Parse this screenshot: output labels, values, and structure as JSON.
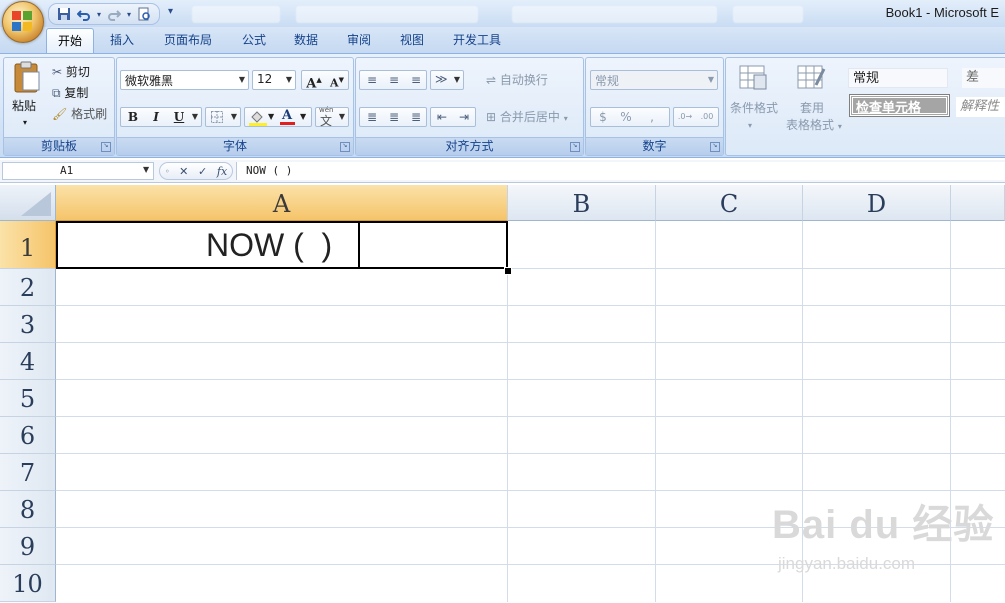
{
  "window": {
    "title": "Book1 - Microsoft E"
  },
  "quick_access": {
    "save_icon": "save-icon",
    "undo_icon": "undo-icon",
    "redo_icon": "redo-icon",
    "print_preview_icon": "print-preview-icon"
  },
  "tabs": [
    "开始",
    "插入",
    "页面布局",
    "公式",
    "数据",
    "审阅",
    "视图",
    "开发工具"
  ],
  "clipboard": {
    "paste_label": "粘贴",
    "cut_label": "剪切",
    "copy_label": "复制",
    "format_painter_label": "格式刷",
    "group_label": "剪贴板"
  },
  "font": {
    "name": "微软雅黑",
    "size": "12",
    "grow_label": "A",
    "shrink_label": "A",
    "bold": "B",
    "italic": "I",
    "underline": "U",
    "phonetic": "wén",
    "group_label": "字体",
    "font_color": "#e02020"
  },
  "alignment": {
    "wrap_label": "自动换行",
    "merge_label": "合并后居中",
    "group_label": "对齐方式"
  },
  "number": {
    "format_value": "常规",
    "percent": "%",
    "comma": ",",
    "group_label": "数字"
  },
  "styles": {
    "conditional_label": "条件格式",
    "table_label": "套用",
    "table_label2": "表格格式",
    "normal_label": "常规",
    "bad_label": "差",
    "check_cell_label": "检查单元格",
    "explain_label": "解释性"
  },
  "formula_bar": {
    "name_box": "A1",
    "formula": "NOW ( )",
    "cancel": "✕",
    "enter": "✓",
    "fx": "fx"
  },
  "sheet": {
    "columns": [
      "A",
      "B",
      "C",
      "D"
    ],
    "rows": [
      "1",
      "2",
      "3",
      "4",
      "5",
      "6",
      "7",
      "8",
      "9",
      "10"
    ],
    "active_cell": "A1",
    "cell_A1": "NOW (  )"
  },
  "watermark": {
    "line1": "Bai du 经验",
    "line2": "jingyan.baidu.com"
  }
}
